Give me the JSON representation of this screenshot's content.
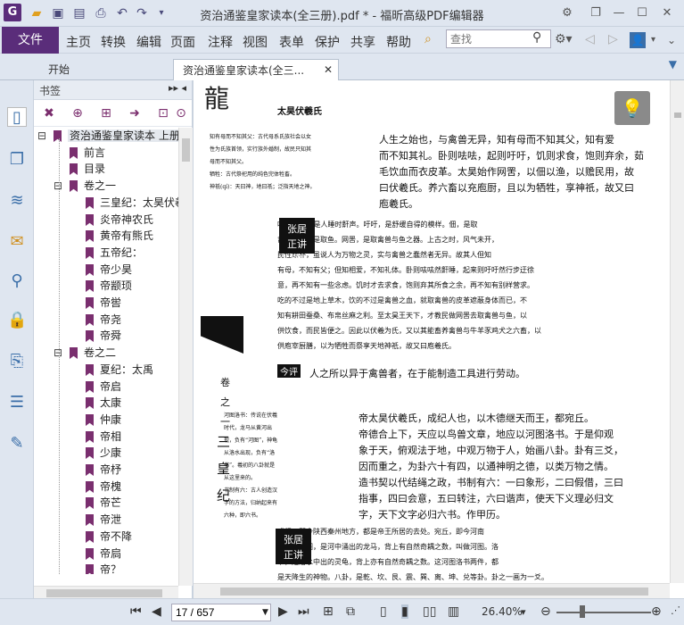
{
  "app": {
    "logo": "G",
    "title": "资治通鉴皇家读本(全三册).pdf * - 福昕高级PDF编辑器"
  },
  "menu": {
    "file": "文件",
    "items": [
      "主页",
      "转换",
      "编辑",
      "页面",
      "注释",
      "视图",
      "表单",
      "保护",
      "共享",
      "帮助"
    ],
    "search_placeholder": "查找"
  },
  "tabs": {
    "start": "开始",
    "doc": "资治通鉴皇家读本(全三..."
  },
  "bookmarks": {
    "header": "书签",
    "root": "资治通鉴皇家读本 上册",
    "items": [
      {
        "label": "前言",
        "level": 1
      },
      {
        "label": "目录",
        "level": 1
      },
      {
        "label": "卷之一",
        "level": 1
      },
      {
        "label": "三皇纪：太昊伏羲",
        "level": 2
      },
      {
        "label": "炎帝神农氏",
        "level": 2
      },
      {
        "label": "黄帝有熊氏",
        "level": 2
      },
      {
        "label": "五帝纪：",
        "level": 2
      },
      {
        "label": "帝少昊",
        "level": 2
      },
      {
        "label": "帝颛顼",
        "level": 2
      },
      {
        "label": "帝喾",
        "level": 2
      },
      {
        "label": "帝尧",
        "level": 2
      },
      {
        "label": "帝舜",
        "level": 2
      },
      {
        "label": "卷之二",
        "level": 1
      },
      {
        "label": "夏纪：太禹",
        "level": 2
      },
      {
        "label": "帝启",
        "level": 2
      },
      {
        "label": "太康",
        "level": 2
      },
      {
        "label": "仲康",
        "level": 2
      },
      {
        "label": "帝相",
        "level": 2
      },
      {
        "label": "少康",
        "level": 2
      },
      {
        "label": "帝杼",
        "level": 2
      },
      {
        "label": "帝槐",
        "level": 2
      },
      {
        "label": "帝芒",
        "level": 2
      },
      {
        "label": "帝泄",
        "level": 2
      },
      {
        "label": "帝不降",
        "level": 2
      },
      {
        "label": "帝扃",
        "level": 2
      },
      {
        "label": "帝？",
        "level": 2
      },
      {
        "label": "孔甲",
        "level": 2
      },
      {
        "label": "帝皋",
        "level": 2
      }
    ]
  },
  "page": {
    "header": "太昊伏羲氏",
    "note1": [
      "知有母而不知其父：古代母系氏族社会以女",
      "性为氏族首领，实行族外婚制，故民只知其",
      "母而不知其父。",
      "牺牲：古代祭祀用的纯色完体牲畜。",
      "神祇(qí)：天曰神，地曰祇；泛指天地之神。"
    ],
    "para1": [
      "人生之始也，与禽兽无异，知有母而不知其父，知有爱",
      "而不知其礼。卧则呿呿，起则吁吁，饥则求食，饱则弃余，茹",
      "毛饮血而衣皮革。太昊始作网罟，以佃以渔，以赡民用，故",
      "曰伏羲氏。养六畜以充庖厨，且以为牺牲，享神祇，故又曰",
      "庖羲氏。"
    ],
    "comment_label": "张居正讲评",
    "comment1": [
      "呿呿(qū)，是人睡时鼾声。吁吁，是舒缓自得的模样。佃，是取",
      "禽兽。渔，是取鱼。网罟，是取禽兽与鱼之器。上古之时，风气未开，",
      "民性顽朴，虽说人为万物之灵，实与禽兽之蠢然者无异。故其人但知",
      "有母，不知有父；但知相爱，不知礼体。卧则呿呿然鼾睡，起来则吁吁然行步迂徐",
      "意，再不知有一些念虑。饥时才去求食，饱则弃其所食之余，再不知有别样营求。",
      "吃的不过是地上草木，饮的不过是禽兽之血，就取禽兽的皮革遮蔽身体而已，不",
      "知有耕田蚕桑、布帛丝麻之利。至太昊王天下，才教民做网罟去取禽兽与鱼，以",
      "供饮食，而民皆便之。因此以伏羲为氏，又以其能畜养禽兽与牛羊豕鸡犬之六畜，以",
      "供庖宰厨膳，以为牺牲而祭享天地神祇，故又曰庖羲氏。"
    ],
    "today_label": "今评",
    "today1": "人之所以异于禽兽者，在于能制造工具进行劳动。",
    "vertical": [
      "卷",
      "之",
      "一",
      "三",
      "皇",
      "纪"
    ],
    "note2": [
      "河图洛书：传说在伏羲",
      "时代，龙马从黄河出",
      "现，负有“河图”，神龟",
      "从洛水出现，负有“洛",
      "书”。羲初的八卦就是",
      "从这里来的。",
      "书制有六：古人创造汉",
      "字的方法，归纳起来有",
      "六种，即六书。"
    ],
    "para2": [
      "帝太昊伏羲氏，成纪人也，以木德继天而王，都宛丘。",
      "帝德合上下，天应以鸟兽文章，地应以河图洛书。于是仰观",
      "象于天，俯观法于地，中观万物于人，始画八卦。卦有三爻，",
      "因而重之，为卦六十有四，以通神明之德，以类万物之情。",
      "造书契以代结绳之政，书制有六：一曰象形，二曰假借，三曰",
      "指事，四曰会意，五曰转注，六曰谐声，使天下义理必归文",
      "字，天下文字必归六书。作甲历。"
    ],
    "comment2": [
      "成纪，即今陕西秦州地方，都是帝王所居的去处。宛丘，即今河南",
      "陈州。河图，是河中涌出的龙马，背上有自然奇耦之数，叫做河图。洛",
      "书，是洛水中出的灵龟，背上亦有自然奇耦之数。这河图洛书两件，都",
      "是天降生的神物。八卦，是乾、坎、艮、震、巽、离、坤、兑等卦。卦之一画为一爻。"
    ]
  },
  "status": {
    "page_value": "17 / 657",
    "zoom": "26.40%"
  }
}
